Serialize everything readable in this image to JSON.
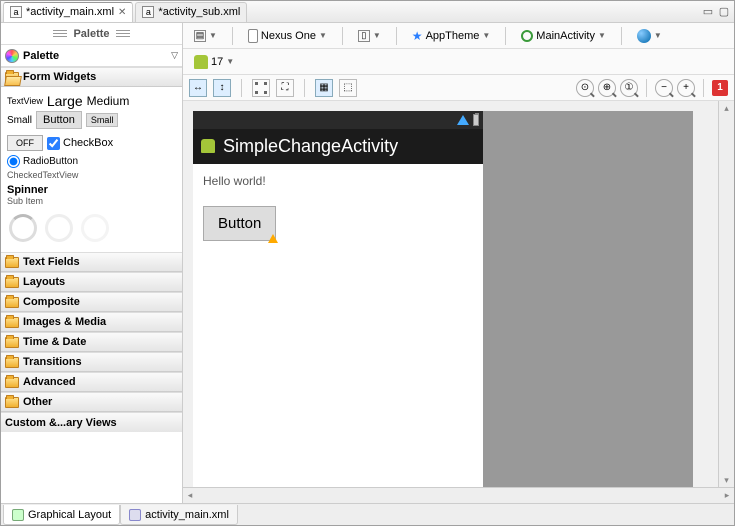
{
  "tabs": {
    "t1": "*activity_main.xml",
    "t2": "*activity_sub.xml"
  },
  "palette": {
    "headerLine": "Palette",
    "title": "Palette",
    "sections": {
      "formWidgets": "Form Widgets",
      "textFields": "Text Fields",
      "layouts": "Layouts",
      "composite": "Composite",
      "imagesMedia": "Images & Media",
      "timeDate": "Time & Date",
      "transitions": "Transitions",
      "advanced": "Advanced",
      "other": "Other",
      "custom": "Custom &...ary Views"
    },
    "fw": {
      "textview": "TextView",
      "large": "Large",
      "medium": "Medium",
      "small": "Small",
      "button": "Button",
      "small2": "Small",
      "off": "OFF",
      "checkbox": "CheckBox",
      "radio": "RadioButton",
      "checkedtv": "CheckedTextView",
      "spinner": "Spinner",
      "subitem": "Sub Item"
    }
  },
  "toolbar": {
    "device": "Nexus One",
    "theme": "AppTheme",
    "activity": "MainActivity",
    "api": "17"
  },
  "preview": {
    "title": "SimpleChangeActivity",
    "hello": "Hello world!",
    "button": "Button"
  },
  "errors": "1",
  "bottomTabs": {
    "graphical": "Graphical Layout",
    "source": "activity_main.xml"
  }
}
